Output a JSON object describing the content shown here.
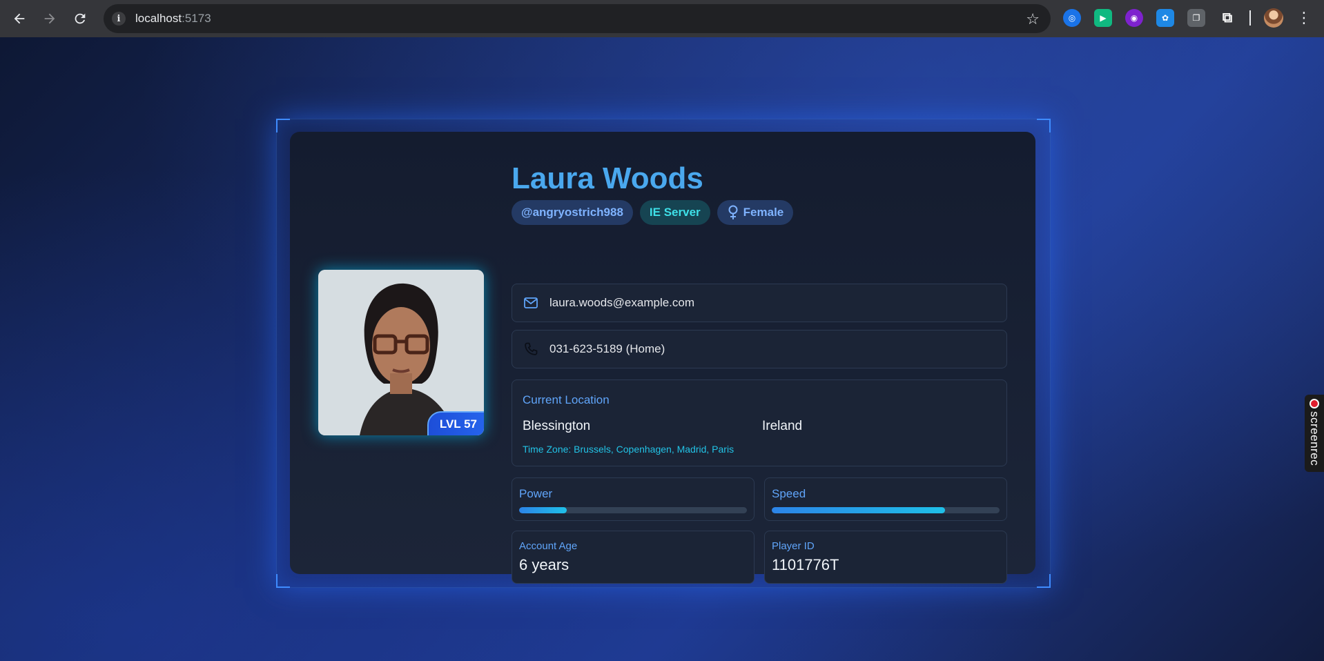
{
  "browser": {
    "url_host": "localhost",
    "url_port": ":5173",
    "extensions": [
      "translate-extension-icon",
      "video-extension-icon",
      "search-extension-icon",
      "team-extension-icon",
      "tabs-extension-icon",
      "extensions-icon"
    ]
  },
  "profile": {
    "name": "Laura Woods",
    "username": "@angryostrich988",
    "server": "IE Server",
    "gender": "Female",
    "level_badge": "LVL 57",
    "email": "laura.woods@example.com",
    "phone": "031-623-5189 (Home)",
    "location": {
      "title": "Current Location",
      "city": "Blessington",
      "country": "Ireland",
      "timezone": "Time Zone: Brussels, Copenhagen, Madrid, Paris"
    },
    "stats": {
      "power": {
        "label": "Power",
        "value": 0.21
      },
      "speed": {
        "label": "Speed",
        "value": 0.76
      }
    },
    "account_age": {
      "label": "Account Age",
      "value": "6 years"
    },
    "player_id": {
      "label": "Player ID",
      "value": "1101776T"
    }
  },
  "overlay": {
    "screenrec_label": "screenrec"
  },
  "colors": {
    "accent": "#4aa8ee",
    "server_tag": "#3ee0e8",
    "bar_fill": "#1fc0e8"
  }
}
